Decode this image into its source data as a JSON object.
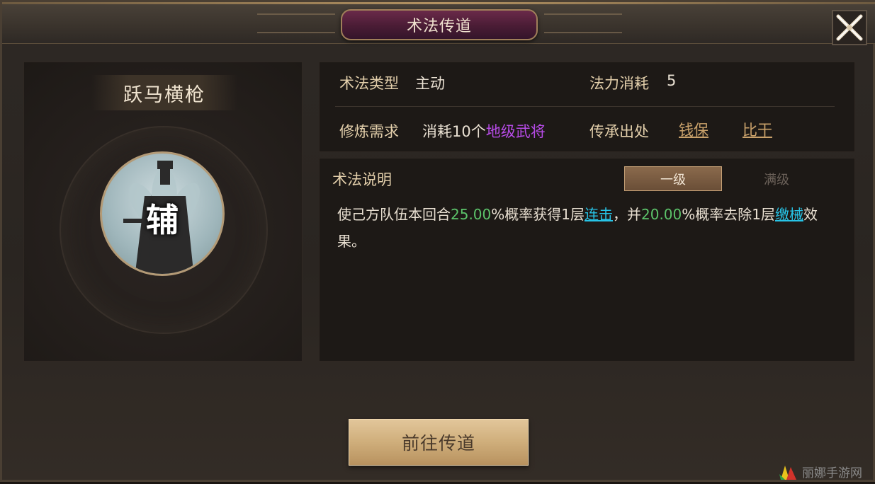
{
  "window": {
    "title": "术法传道"
  },
  "skill": {
    "name": "跃马横枪",
    "portrait_text": "辅"
  },
  "info": {
    "type_label": "术法类型",
    "type_value": "主动",
    "mana_label": "法力消耗",
    "mana_value": "5",
    "req_label": "修炼需求",
    "req_prefix": "消耗10个",
    "req_highlight": "地级武将",
    "source_label": "传承出处",
    "sources": [
      "钱保",
      "比干"
    ]
  },
  "description": {
    "label": "术法说明",
    "tabs": [
      "一级",
      "满级"
    ],
    "active_tab": "一级",
    "segments": {
      "s1": "使己方队伍本回合",
      "s2": "25.00",
      "s3": "%概率获得1层",
      "s4": "连击",
      "s5": "，并",
      "s6": "20.00",
      "s7": "%概率去除1层",
      "s8": "缴械",
      "s9": "效果。"
    }
  },
  "actions": {
    "go_button": "前往传道"
  },
  "watermark": {
    "text": "丽娜手游网"
  },
  "colors": {
    "accent_purple": "#b64be6",
    "accent_green": "#5cc36a",
    "accent_cyan": "#27c3e6",
    "label_gold": "#e3cfab",
    "button_gold": "#cfae7b"
  },
  "icons": {
    "close": "close-icon",
    "watermark_logo": "watermark-logo-icon"
  }
}
